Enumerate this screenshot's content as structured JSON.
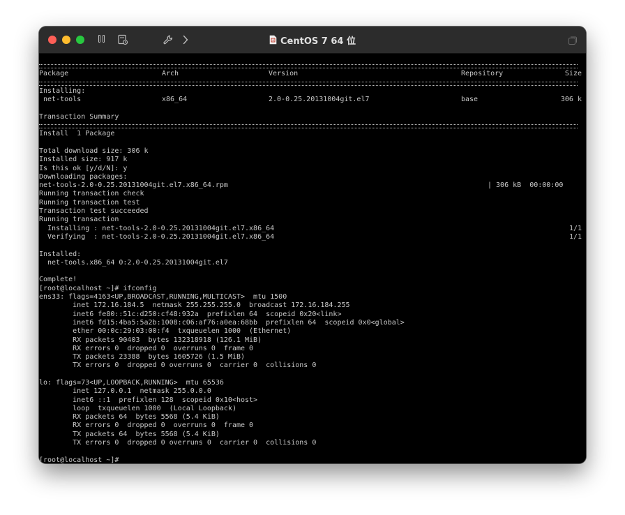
{
  "window": {
    "title": "CentOS 7 64 位"
  },
  "table": {
    "headers": [
      "Package",
      "Arch",
      "Version",
      "Repository",
      "Size"
    ],
    "section_label": "Installing:",
    "row": [
      " net-tools",
      "x86_64",
      "2.0-0.25.20131004git.el7",
      "base",
      "306 k"
    ]
  },
  "console": {
    "summary_title": "Transaction Summary",
    "summary_line": "Install  1 Package",
    "lines_after_summary": [
      "",
      "Total download size: 306 k",
      "Installed size: 917 k",
      "Is this ok [y/d/N]: y",
      "Downloading packages:"
    ],
    "download_file": "net-tools-2.0-0.25.20131004git.el7.x86_64.rpm",
    "download_progress": "| 306 kB  00:00:00",
    "transaction_lines": [
      "Running transaction check",
      "Running transaction test",
      "Transaction test succeeded",
      "Running transaction"
    ],
    "installing_line": "  Installing : net-tools-2.0-0.25.20131004git.el7.x86_64",
    "installing_count": "1/1",
    "verifying_line": "  Verifying  : net-tools-2.0-0.25.20131004git.el7.x86_64",
    "verifying_count": "1/1",
    "tail_lines": [
      "",
      "Installed:",
      "  net-tools.x86_64 0:2.0-0.25.20131004git.el7",
      "",
      "Complete!",
      "[root@localhost ~]# ifconfig",
      "ens33: flags=4163<UP,BROADCAST,RUNNING,MULTICAST>  mtu 1500",
      "        inet 172.16.184.5  netmask 255.255.255.0  broadcast 172.16.184.255",
      "        inet6 fe80::51c:d250:cf48:932a  prefixlen 64  scopeid 0x20<link>",
      "        inet6 fd15:4ba5:5a2b:1008:c06:af76:a0ea:68bb  prefixlen 64  scopeid 0x0<global>",
      "        ether 00:0c:29:03:00:f4  txqueuelen 1000  (Ethernet)",
      "        RX packets 90403  bytes 132318918 (126.1 MiB)",
      "        RX errors 0  dropped 0  overruns 0  frame 0",
      "        TX packets 23388  bytes 1605726 (1.5 MiB)",
      "        TX errors 0  dropped 0 overruns 0  carrier 0  collisions 0",
      "",
      "lo: flags=73<UP,LOOPBACK,RUNNING>  mtu 65536",
      "        inet 127.0.0.1  netmask 255.0.0.0",
      "        inet6 ::1  prefixlen 128  scopeid 0x10<host>",
      "        loop  txqueuelen 1000  (Local Loopback)",
      "        RX packets 64  bytes 5568 (5.4 KiB)",
      "        RX errors 0  dropped 0  overruns 0  frame 0",
      "        TX packets 64  bytes 5568 (5.4 KiB)",
      "        TX errors 0  dropped 0 overruns 0  carrier 0  collisions 0",
      "",
      "[root@localhost ~]#"
    ]
  },
  "icons": {
    "pause": "pause-icon",
    "snapshot": "snapshot-icon",
    "settings": "wrench-icon",
    "forward": "chevron-right-icon",
    "vm": "vm-document-icon",
    "restore": "restore-window-icon"
  },
  "colors": {
    "console_bg": "#000000",
    "console_text": "#c9c9c9",
    "titlebar_bg": "#2c2c2c",
    "close": "#fe5f57",
    "minimize": "#febc2e",
    "zoom": "#28c840"
  }
}
